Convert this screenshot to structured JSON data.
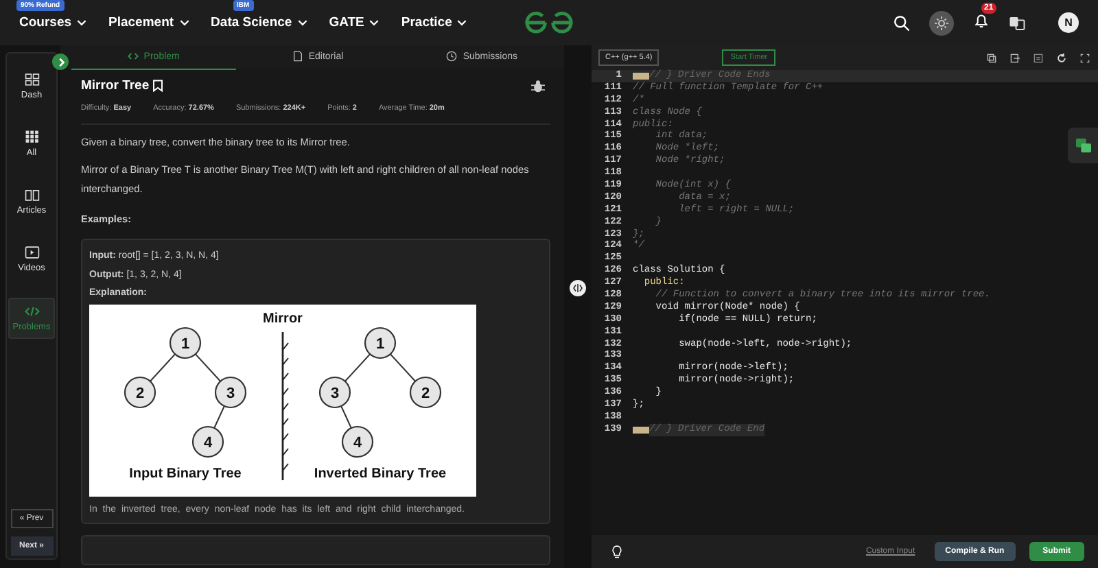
{
  "nav": {
    "items": [
      {
        "label": "Courses",
        "badge": "90% Refund"
      },
      {
        "label": "Placement"
      },
      {
        "label": "Data Science",
        "badge": "IBM"
      },
      {
        "label": "GATE"
      },
      {
        "label": "Practice"
      }
    ],
    "notifications": "21",
    "avatar": "N"
  },
  "sidebar": {
    "items": [
      {
        "label": "Dash",
        "selected": false
      },
      {
        "label": "All",
        "selected": false
      },
      {
        "label": "Articles",
        "selected": false
      },
      {
        "label": "Videos",
        "selected": false
      },
      {
        "label": "Problems",
        "selected": true
      }
    ],
    "prev": "« Prev",
    "next": "Next »"
  },
  "tabs": [
    {
      "label": "Problem",
      "selected": true
    },
    {
      "label": "Editorial",
      "selected": false
    },
    {
      "label": "Submissions",
      "selected": false
    }
  ],
  "problem": {
    "title": "Mirror Tree",
    "meta": [
      {
        "label": "Difficulty:",
        "value": "Easy"
      },
      {
        "label": "Accuracy:",
        "value": "72.67%"
      },
      {
        "label": "Submissions:",
        "value": "224K+"
      },
      {
        "label": "Points:",
        "value": "2"
      },
      {
        "label": "Average Time:",
        "value": "20m"
      }
    ],
    "paragraphs": [
      "Given a binary tree, convert the binary tree to its Mirror tree.",
      "Mirror of a Binary Tree T is another Binary Tree M(T) with left and right children of all non-leaf nodes interchanged."
    ],
    "examples_heading": "Examples:",
    "example": {
      "lines": [
        "**Input:** root[] = [1, 2, 3, N, N, 4]",
        "**Output:** [1, 3, 2, N, 4]"
      ],
      "explanation": "Explanation:",
      "diagram": {
        "title": "Mirror",
        "trees": [
          {
            "caption": "Input Binary Tree",
            "root": {
              "label": "1",
              "left": {
                "label": "2"
              },
              "right": {
                "label": "3",
                "left": {
                  "label": "4"
                }
              }
            }
          },
          {
            "caption": "Inverted Binary Tree",
            "root": {
              "label": "1",
              "left": {
                "label": "3",
                "right": {
                  "label": "4"
                }
              },
              "right": {
                "label": "2"
              }
            }
          }
        ]
      },
      "caption": "In the inverted tree, every non-leaf node has its left and right child interchanged."
    }
  },
  "editor": {
    "language": "C++ (g++ 5.4)",
    "timer": "Start Timer",
    "lines": [
      {
        "n": "1",
        "kind": "fold",
        "code": "// } Driver Code Ends"
      },
      {
        "n": "111",
        "kind": "comment",
        "code": "// Full function Template for C++"
      },
      {
        "n": "112",
        "kind": "comment",
        "code": "/*"
      },
      {
        "n": "113",
        "kind": "comment",
        "code": "class Node {"
      },
      {
        "n": "114",
        "kind": "comment",
        "code": "public:"
      },
      {
        "n": "115",
        "kind": "comment",
        "code": "    int data;"
      },
      {
        "n": "116",
        "kind": "comment",
        "code": "    Node *left;"
      },
      {
        "n": "117",
        "kind": "comment",
        "code": "    Node *right;"
      },
      {
        "n": "118",
        "kind": "comment"
      },
      {
        "n": "119",
        "kind": "comment",
        "code": "    Node(int x) {"
      },
      {
        "n": "120",
        "kind": "comment",
        "code": "        data = x;"
      },
      {
        "n": "121",
        "kind": "comment",
        "code": "        left = right = NULL;"
      },
      {
        "n": "122",
        "kind": "comment",
        "code": "    }"
      },
      {
        "n": "123",
        "kind": "comment",
        "code": "};"
      },
      {
        "n": "124",
        "kind": "comment",
        "code": "*/"
      },
      {
        "n": "125",
        "kind": "code"
      },
      {
        "n": "126",
        "kind": "code",
        "code": "class Solution {"
      },
      {
        "n": "127",
        "kind": "keyword",
        "code": "  public:"
      },
      {
        "n": "128",
        "kind": "comment",
        "code": "    // Function to convert a binary tree into its mirror tree."
      },
      {
        "n": "129",
        "kind": "code",
        "code": "    void mirror(Node* node) {"
      },
      {
        "n": "130",
        "kind": "code",
        "code": "        if(node == NULL) return;"
      },
      {
        "n": "131",
        "kind": "code"
      },
      {
        "n": "132",
        "kind": "code",
        "code": "        swap(node->left, node->right);"
      },
      {
        "n": "133",
        "kind": "code"
      },
      {
        "n": "134",
        "kind": "code",
        "code": "        mirror(node->left);"
      },
      {
        "n": "135",
        "kind": "code",
        "code": "        mirror(node->right);"
      },
      {
        "n": "136",
        "kind": "code",
        "code": "    }"
      },
      {
        "n": "137",
        "kind": "code",
        "code": "};"
      },
      {
        "n": "138",
        "kind": "code"
      },
      {
        "n": "139",
        "kind": "fold",
        "code": "// } Driver Code End"
      }
    ],
    "custom_input": "Custom Input",
    "compile": "Compile & Run",
    "submit": "Submit"
  }
}
